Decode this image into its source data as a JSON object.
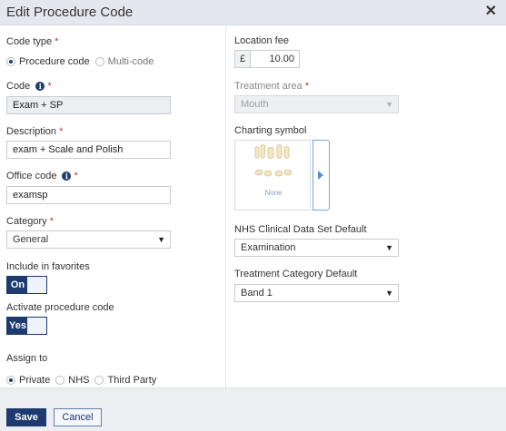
{
  "dialog": {
    "title": "Edit Procedure Code",
    "close_glyph": "✕"
  },
  "left": {
    "code_type": {
      "label": "Code type",
      "required": "*",
      "options": [
        {
          "label": "Procedure code",
          "selected": true
        },
        {
          "label": "Multi-code",
          "selected": false
        }
      ]
    },
    "code": {
      "label": "Code",
      "required": "*",
      "value": "Exam + SP"
    },
    "description": {
      "label": "Description",
      "required": "*",
      "value": "exam + Scale and Polish"
    },
    "office_code": {
      "label": "Office code",
      "required": "*",
      "value": "examsp"
    },
    "category": {
      "label": "Category",
      "required": "*",
      "value": "General"
    },
    "include_favorites": {
      "label": "Include in favorites",
      "toggle_text": "On"
    },
    "activate": {
      "label": "Activate procedure code",
      "toggle_text": "Yes"
    },
    "assign_to": {
      "label": "Assign to",
      "options": [
        {
          "label": "Private",
          "selected": true
        },
        {
          "label": "NHS",
          "selected": false
        },
        {
          "label": "Third Party",
          "selected": false
        }
      ]
    }
  },
  "right": {
    "location_fee": {
      "label": "Location fee",
      "currency": "£",
      "value": "10.00"
    },
    "treatment_area": {
      "label": "Treatment area",
      "required": "*",
      "value": "Mouth"
    },
    "charting_symbol": {
      "label": "Charting symbol",
      "none_text": "None"
    },
    "nhs_default": {
      "label": "NHS Clinical Data Set Default",
      "value": "Examination"
    },
    "treatment_category": {
      "label": "Treatment Category Default",
      "value": "Band 1"
    }
  },
  "info_icon_glyph": "i",
  "dropdown_glyph": "▼",
  "footer": {
    "save_label": "Save",
    "cancel_label": "Cancel"
  },
  "colors": {
    "accent": "#1f3a6e",
    "required": "#c0392b",
    "titlebar": "#e4e8ee"
  }
}
